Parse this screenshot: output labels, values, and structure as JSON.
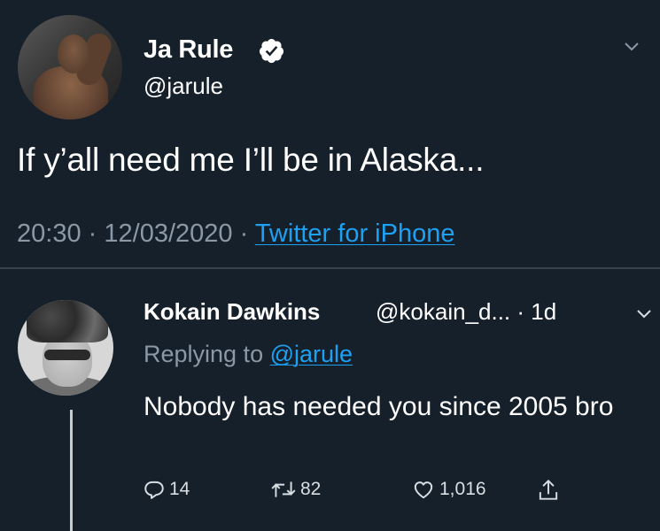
{
  "tweet": {
    "author_name": "Ja Rule",
    "author_handle": "@jarule",
    "verified_icon": "verified-badge-icon",
    "text": "If y’all need me I’ll be in Alaska...",
    "time": "20:30",
    "date": "12/03/2020",
    "separator": "·",
    "source": "Twitter for iPhone",
    "menu_icon": "chevron-down-icon"
  },
  "reply": {
    "author_name": "Kokain Dawkins",
    "author_handle": "@kokain_d... · 1d",
    "replying_label": "Replying to",
    "replying_mention": "@jarule",
    "text": "Nobody has needed you since 2005 bro",
    "menu_icon": "chevron-down-icon",
    "actions": {
      "reply_count": "14",
      "retweet_count": "82",
      "like_count": "1,016"
    }
  },
  "colors": {
    "background": "#15202b",
    "link": "#1da1f2",
    "muted": "#8b98a5",
    "divider": "#38444d"
  }
}
